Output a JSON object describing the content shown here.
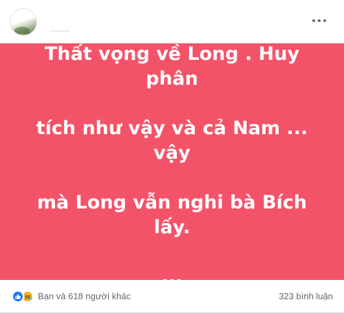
{
  "post": {
    "text": "Thất vọng về Long . Huy phân tích như vậy và cả Nam ... vậy mà Long vẫn nghi bà Bích lấy. ...",
    "text_lines": [
      "Thất vọng về Long . Huy phân",
      "tích như vậy và cả Nam ... vậy",
      "mà Long vẫn nghi bà Bích lấy.",
      "..."
    ],
    "background_color": "#f35369",
    "text_color": "#ffffff"
  },
  "header": {
    "more_icon": "more-horizontal-icon"
  },
  "footer": {
    "reaction_icons": [
      "like-icon",
      "sad-icon"
    ],
    "reactions_text": "Bạn và 618 người khác",
    "comments_text": "323 bình luận"
  },
  "colors": {
    "accent": "#1877f2",
    "muted_text": "#65676b"
  }
}
